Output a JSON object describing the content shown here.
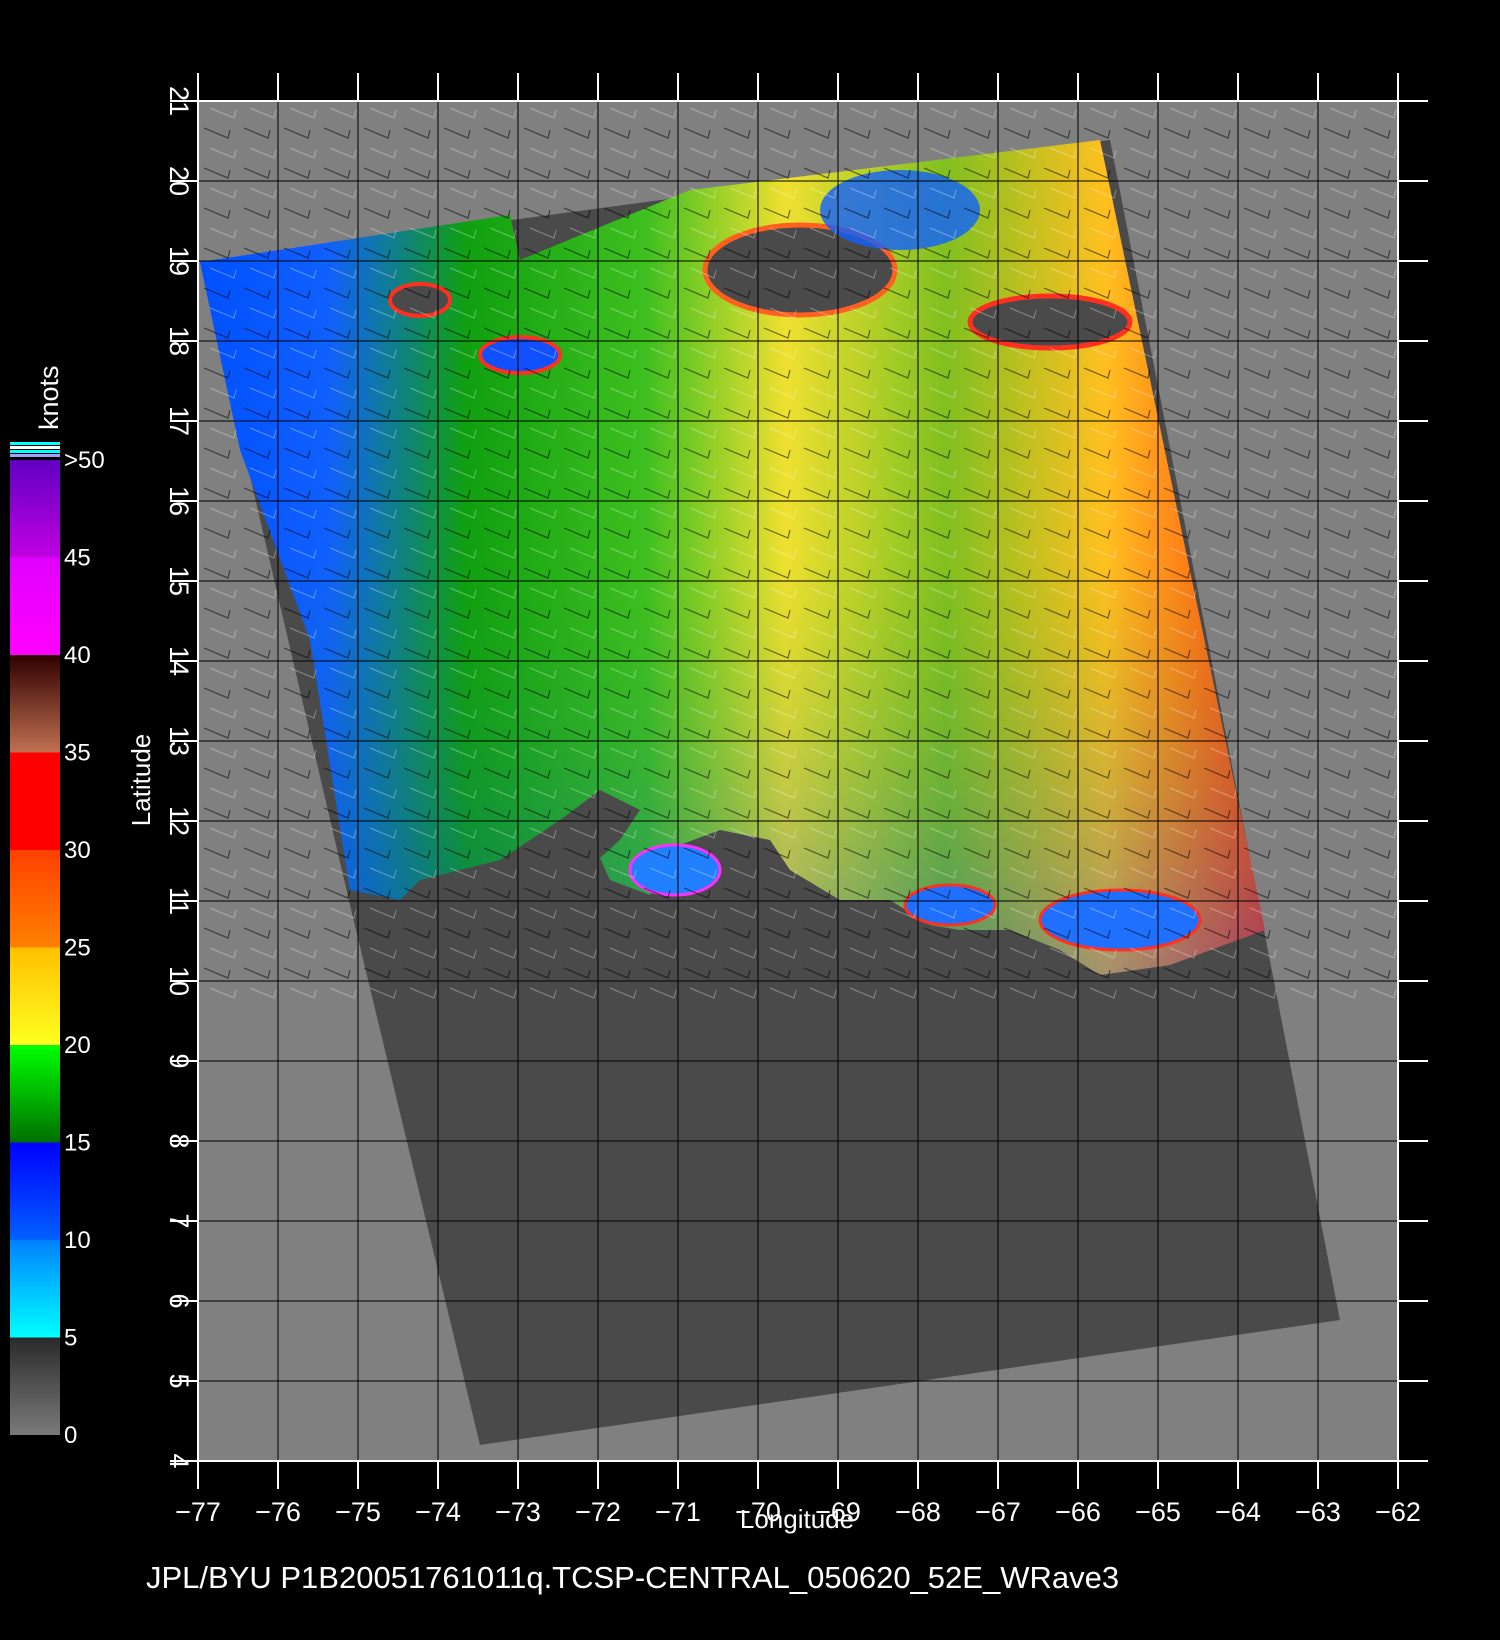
{
  "map": {
    "x_label": "Longitude",
    "y_label": "Latitude",
    "lon_range": [
      -77,
      -62
    ],
    "lat_range": [
      4,
      21
    ],
    "lon_ticks": [
      -77,
      -76,
      -75,
      -74,
      -73,
      -72,
      -71,
      -70,
      -69,
      -68,
      -67,
      -66,
      -65,
      -64,
      -63,
      -62
    ],
    "lat_ticks": [
      4,
      5,
      6,
      7,
      8,
      9,
      10,
      11,
      12,
      13,
      14,
      15,
      16,
      17,
      18,
      19,
      20,
      21
    ],
    "background_color": "#808080",
    "swath_color": "#4a4a4a",
    "land_color": "#4a4a4a",
    "grid": true
  },
  "colorbar": {
    "unit": "knots",
    "labels": [
      "0",
      "5",
      "10",
      "15",
      "20",
      "25",
      "30",
      "35",
      "40",
      "45",
      ">50"
    ],
    "bands": [
      {
        "from": 0,
        "to": 5,
        "colors": [
          "#7a7a7a",
          "#2a2a2a"
        ]
      },
      {
        "from": 5,
        "to": 10,
        "colors": [
          "#00ffff",
          "#0080ff"
        ]
      },
      {
        "from": 10,
        "to": 15,
        "colors": [
          "#0060ff",
          "#0000ff"
        ]
      },
      {
        "from": 15,
        "to": 20,
        "colors": [
          "#007000",
          "#00ff00"
        ]
      },
      {
        "from": 20,
        "to": 25,
        "colors": [
          "#ffff20",
          "#ffc000"
        ]
      },
      {
        "from": 25,
        "to": 30,
        "colors": [
          "#ff8000",
          "#ff4000"
        ]
      },
      {
        "from": 30,
        "to": 35,
        "colors": [
          "#ff0000",
          "#ff0000"
        ]
      },
      {
        "from": 35,
        "to": 40,
        "colors": [
          "#c07050",
          "#300000"
        ]
      },
      {
        "from": 40,
        "to": 45,
        "colors": [
          "#ff00ff",
          "#e000ff"
        ]
      },
      {
        "from": 45,
        "to": 50,
        "colors": [
          "#c000e0",
          "#6000c0"
        ]
      }
    ],
    "top_stripes": [
      "#00ffff",
      "#ffffff",
      "#00ffff",
      "#a0a0ff"
    ]
  },
  "footer": "JPL/BYU  P1B20051761011q.TCSP-CENTRAL_050620_52E_WRave3"
}
